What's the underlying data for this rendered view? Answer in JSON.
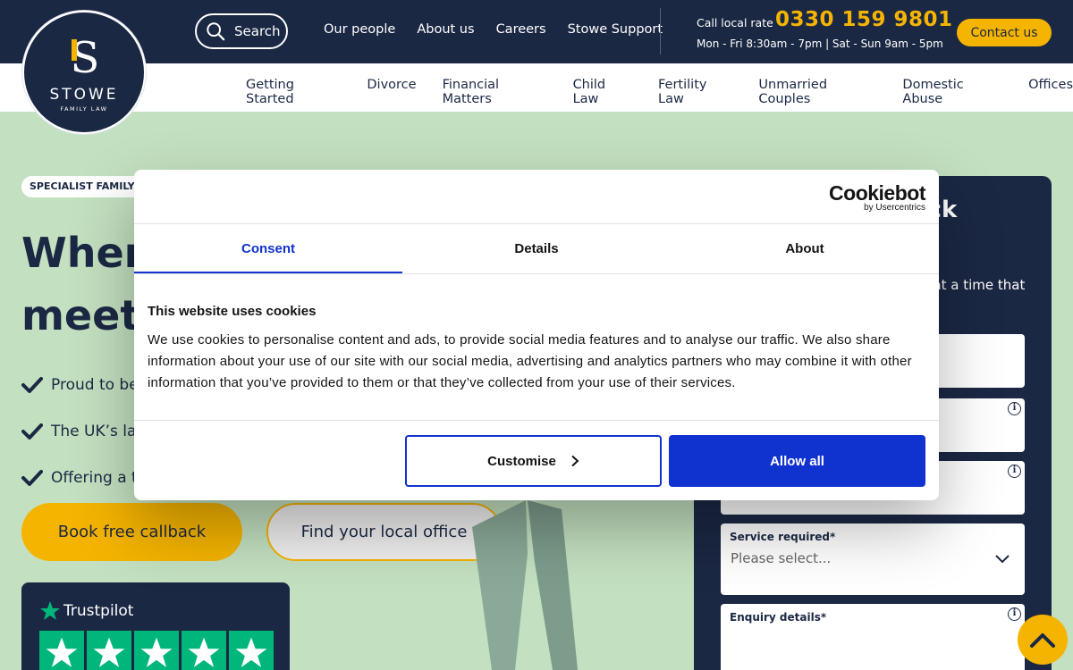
{
  "brand": {
    "name": "STOWE",
    "subtitle": "FAMILY LAW"
  },
  "header": {
    "search_label": "Search",
    "top_links": [
      "Our people",
      "About us",
      "Careers",
      "Stowe Support"
    ],
    "call_rate": "Call local rate",
    "phone": "0330 159 9801",
    "hours": "Mon - Fri 8:30am - 7pm | Sat - Sun 9am - 5pm",
    "contact_label": "Contact us"
  },
  "nav": [
    "Getting Started",
    "Divorce",
    "Financial Matters",
    "Child Law",
    "Fertility Law",
    "Unmarried Couples",
    "Domestic Abuse",
    "Offices"
  ],
  "hero": {
    "badge": "SPECIALIST FAMILY L",
    "title_line1": "Wher",
    "title_line2": "meets",
    "checks": [
      "Proud to be",
      "The UK’s lar",
      "Offering a t"
    ],
    "btn_callback": "Book free callback",
    "btn_office": "Find your local office"
  },
  "trustpilot": {
    "label": "Trustpilot",
    "stars": 5
  },
  "form": {
    "title_fragment": "ack",
    "sub_fragment": "k at a time that",
    "service_label": "Service required*",
    "service_placeholder": "Please select...",
    "enquiry_label": "Enquiry details*",
    "info_glyph": "i"
  },
  "cookie": {
    "logo_big": "Cookiebot",
    "logo_small": "by Usercentrics",
    "tabs": [
      "Consent",
      "Details",
      "About"
    ],
    "title": "This website uses cookies",
    "text": "We use cookies to personalise content and ads, to provide social media features and to analyse our traffic. We also share information about your use of our site with our social media, advertising and analytics partners who may combine it with other information that you’ve provided to them or that they’ve collected from your use of their services.",
    "customise_label": "Customise",
    "allow_label": "Allow all"
  },
  "colors": {
    "navy": "#1b2844",
    "gold": "#f5b400",
    "mint": "#c3e0c0",
    "cookie_blue": "#1032cf",
    "trustpilot_green": "#00b67a"
  }
}
